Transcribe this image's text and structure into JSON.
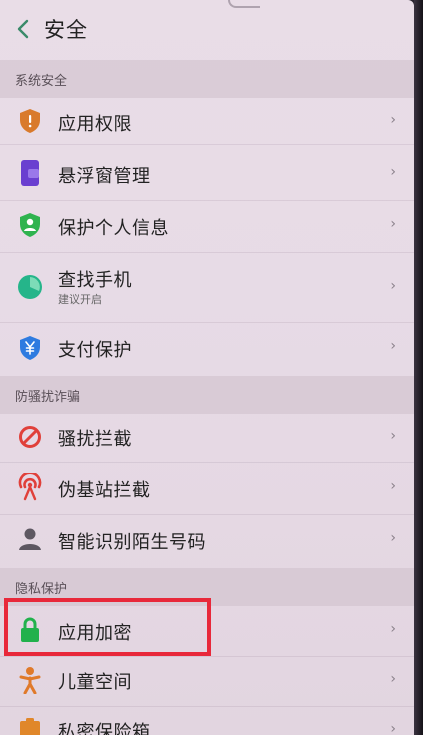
{
  "header": {
    "title": "安全"
  },
  "sections": [
    {
      "title": "系统安全"
    },
    {
      "title": "防骚扰诈骗"
    },
    {
      "title": "隐私保护"
    }
  ],
  "items": [
    {
      "label": "应用权限",
      "icon": "shield-icon",
      "color": "#d97a2b"
    },
    {
      "label": "悬浮窗管理",
      "icon": "floating-window-icon",
      "color": "#6a3fd0"
    },
    {
      "label": "保护个人信息",
      "icon": "person-shield-icon",
      "color": "#2fb34f"
    },
    {
      "label": "查找手机",
      "subtitle": "建议开启",
      "icon": "find-phone-icon",
      "color": "#25b58a"
    },
    {
      "label": "支付保护",
      "icon": "payment-shield-icon",
      "color": "#2e7be0"
    },
    {
      "label": "骚扰拦截",
      "icon": "block-icon",
      "color": "#e0403a"
    },
    {
      "label": "伪基站拦截",
      "icon": "signal-tower-icon",
      "color": "#e0403a"
    },
    {
      "label": "智能识别陌生号码",
      "icon": "contact-icon",
      "color": "#6b6470"
    },
    {
      "label": "应用加密",
      "icon": "lock-icon",
      "color": "#22b14c"
    },
    {
      "label": "儿童空间",
      "icon": "child-icon",
      "color": "#e07a2a"
    },
    {
      "label": "私密保险箱",
      "icon": "safe-icon",
      "color": "#e0872a"
    }
  ],
  "chevron": "›",
  "highlight_color": "#e8283a"
}
